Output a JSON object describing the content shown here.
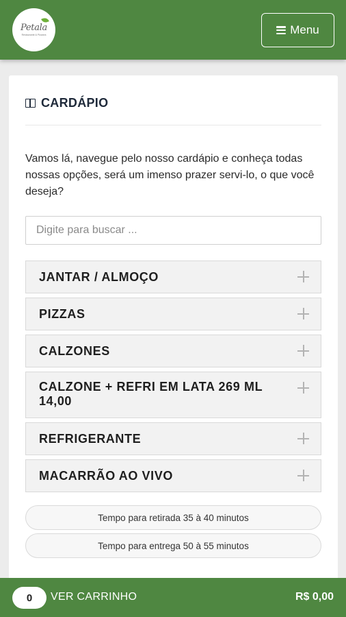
{
  "header": {
    "logo_text": "Petala",
    "logo_subtext": "Restaurante & Pizzaria",
    "menu_label": "Menu"
  },
  "section": {
    "title": "CARDÁPIO",
    "intro": "Vamos lá, navegue pelo nosso cardápio e conheça todas nossas opções, será um imenso prazer servi-lo, o que você deseja?"
  },
  "search": {
    "placeholder": "Digite para buscar ..."
  },
  "categories": [
    {
      "label": "JANTAR / ALMOÇO"
    },
    {
      "label": "PIZZAS"
    },
    {
      "label": "CALZONES"
    },
    {
      "label": "CALZONE + REFRI EM LATA 269 ML 14,00"
    },
    {
      "label": "REFRIGERANTE"
    },
    {
      "label": "MACARRÃO AO VIVO"
    }
  ],
  "info": {
    "pickup_time": "Tempo para retirada 35 à 40 minutos",
    "delivery_time": "Tempo para entrega 50 à 55 minutos"
  },
  "cart": {
    "count": "0",
    "label": "VER CARRINHO",
    "total": "R$ 0,00"
  },
  "colors": {
    "brand_green": "#4f8741",
    "card_bg": "#ffffff",
    "page_bg": "#ececec"
  }
}
